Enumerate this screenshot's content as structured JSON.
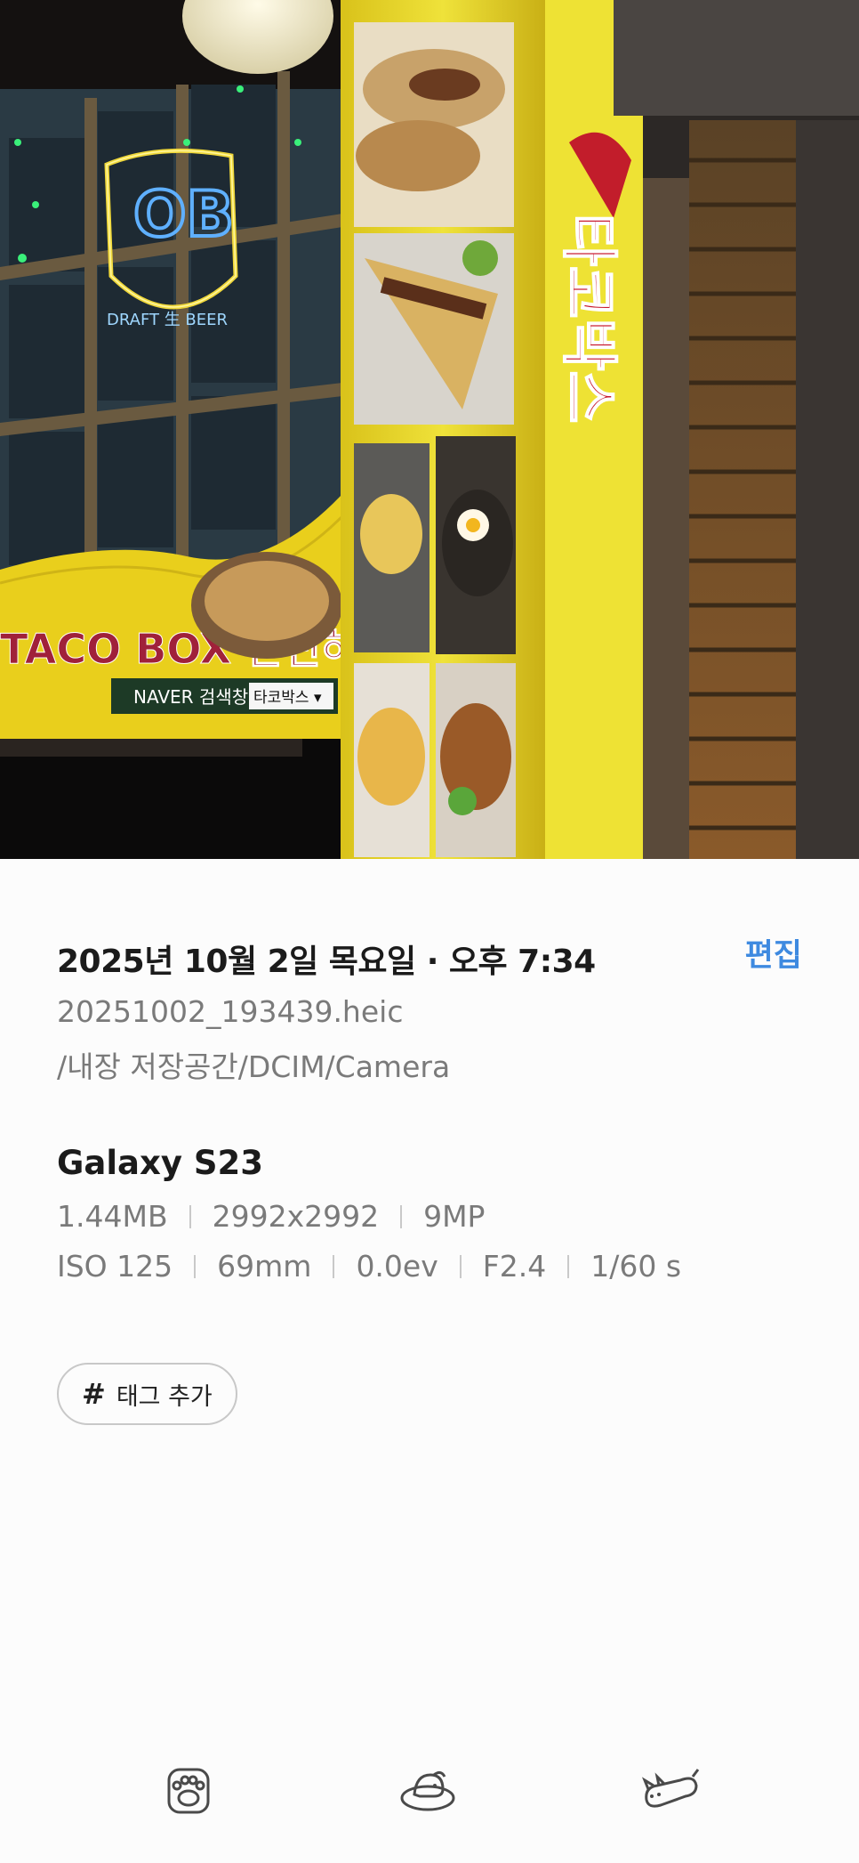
{
  "photo": {
    "neon_sign_text": "OB",
    "neon_sign_sub": "DRAFT 生 BEER",
    "banner_text": "TACO BOX 간편하게 맛있게",
    "naver_text": "NAVER 검색창에",
    "naver_search": "타코박스 ▾",
    "vertical_sign_text": "타코박스"
  },
  "info": {
    "date_time": "2025년 10월 2일 목요일 · 오후 7:34",
    "edit_label": "편집",
    "file_name": "20251002_193439.heic",
    "file_path": "/내장 저장공간/DCIM/Camera",
    "device": "Galaxy S23",
    "specs_row1": [
      "1.44MB",
      "2992x2992",
      "9MP"
    ],
    "specs_row2": [
      "ISO 125",
      "69mm",
      "0.0ev",
      "F2.4",
      "1/60 s"
    ],
    "tag_hash": "#",
    "tag_label": "태그 추가"
  },
  "bottom_bar": {
    "items": [
      "paw-icon",
      "pet-bed-icon",
      "flying-cat-icon"
    ]
  },
  "colors": {
    "accent": "#3e8ae0",
    "title_text": "#1b1b1b",
    "secondary_text": "#7a7a7a"
  }
}
